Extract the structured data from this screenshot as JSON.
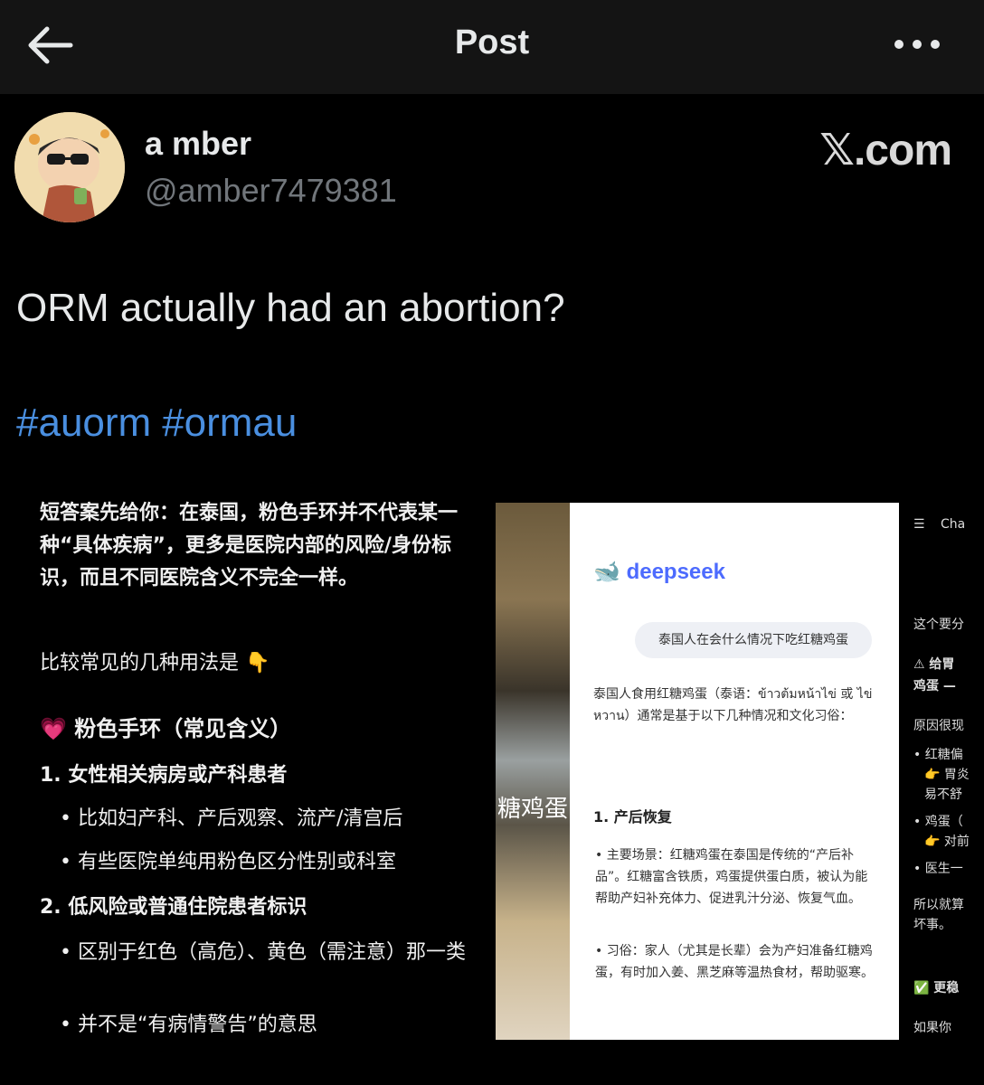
{
  "header": {
    "title": "Post"
  },
  "author": {
    "display_name": "a mber",
    "handle": "@amber7479381"
  },
  "watermark": "𝕏.com",
  "post": {
    "text": "ORM actually had an abortion?",
    "hashtags": [
      "#auorm",
      "#ormau"
    ]
  },
  "screenshot_left": {
    "intro": "短答案先给你：在泰国，粉色手环并不代表某一种“具体疾病”，更多是医院内部的风险/身份标识，而且不同医院含义不完全一样。",
    "lead": "比较常见的几种用法是 👇",
    "heading": "💗 粉色手环（常见含义）",
    "item1": "1. 女性相关病房或产科患者",
    "item1_b1": "• 比如妇产科、产后观察、流产/清宫后",
    "item1_b2": "• 有些医院单纯用粉色区分性别或科室",
    "item2": "2. 低风险或普通住院患者标识",
    "item2_b1": "• 区别于红色（高危）、黄色（需注意）那一类",
    "item2_b2": "• 并不是“有病情警告”的意思"
  },
  "screenshot_mid": {
    "brand": "deepseek",
    "question": "泰国人在会什么情况下吃红糖鸡蛋",
    "answer_intro": "泰国人食用红糖鸡蛋（泰语：ข้าวต้มหน้าไข่ 或 ไข่หวาน）通常是基于以下几种情况和文化习俗：",
    "section1": "1. 产后恢复",
    "bullet1": "• 主要场景：红糖鸡蛋在泰国是传统的“产后补品”。红糖富含铁质，鸡蛋提供蛋白质，被认为能帮助产妇补充体力、促进乳汁分泌、恢复气血。",
    "bullet2": "• 习俗：家人（尤其是长辈）会为产妇准备红糖鸡蛋，有时加入姜、黑芝麻等温热食材，帮助驱寒。",
    "photo_caption": "糖鸡蛋"
  },
  "screenshot_right": {
    "top": "Cha",
    "l1": "这个要分",
    "l2": "⚠ 给胃",
    "l3": "鸡蛋 —",
    "l4": "原因很现",
    "l5": "• 红糖偏",
    "l6": "👉 胃炎",
    "l7": "易不舒",
    "l8": "• 鸡蛋（",
    "l9": "👉 对前",
    "l10": "• 医生一",
    "l11": "所以就算",
    "l12": "坏事。",
    "l13": "✅ 更稳",
    "l14": "如果你"
  }
}
